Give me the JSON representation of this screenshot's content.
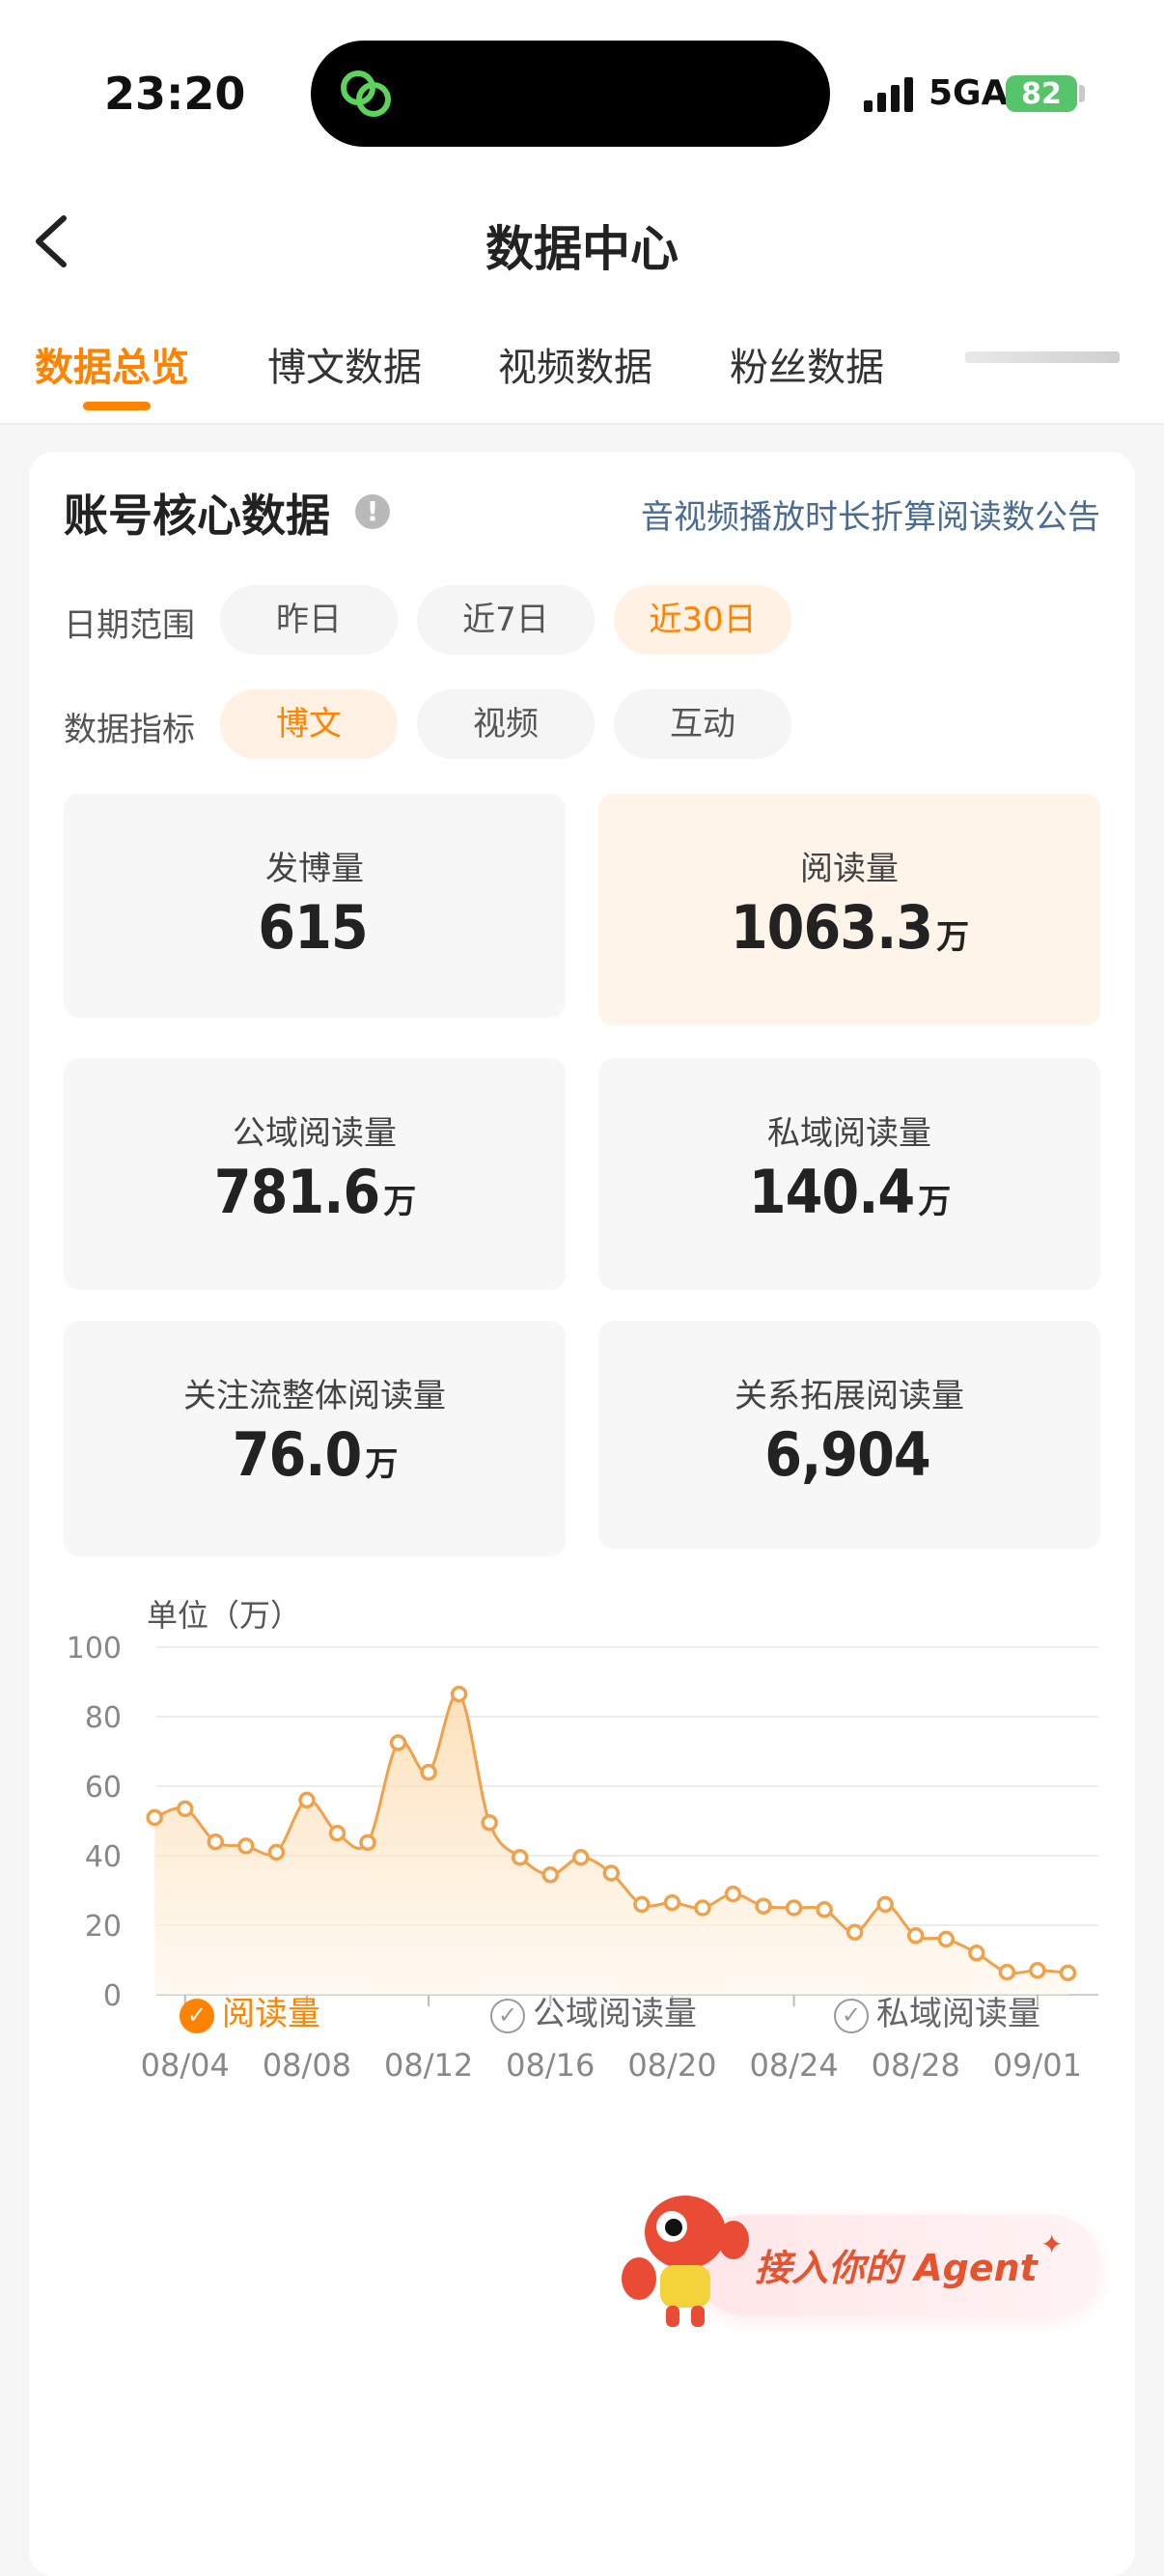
{
  "status": {
    "time": "23:20",
    "network": "5GA",
    "battery": "82"
  },
  "header": {
    "title": "数据中心"
  },
  "tabs": [
    {
      "label": "数据总览",
      "active": true
    },
    {
      "label": "博文数据"
    },
    {
      "label": "视频数据"
    },
    {
      "label": "粉丝数据"
    }
  ],
  "card": {
    "title": "账号核心数据",
    "notice": "音视频播放时长折算阅读数公告",
    "date_label": "日期范围",
    "date_options": [
      "昨日",
      "近7日",
      "近30日"
    ],
    "date_selected": "近30日",
    "metric_label": "数据指标",
    "metric_options": [
      "博文",
      "视频",
      "互动"
    ],
    "metric_selected": "博文"
  },
  "metrics": [
    {
      "label": "发博量",
      "value": "615",
      "unit": ""
    },
    {
      "label": "阅读量",
      "value": "1063.3",
      "unit": "万"
    },
    {
      "label": "公域阅读量",
      "value": "781.6",
      "unit": "万"
    },
    {
      "label": "私域阅读量",
      "value": "140.4",
      "unit": "万"
    },
    {
      "label": "关注流整体阅读量",
      "value": "76.0",
      "unit": "万"
    },
    {
      "label": "关系拓展阅读量",
      "value": "6,904",
      "unit": ""
    }
  ],
  "chart_unit": "单位（万）",
  "chart_data": {
    "type": "area",
    "x": [
      "08/03",
      "08/04",
      "08/05",
      "08/06",
      "08/07",
      "08/08",
      "08/09",
      "08/10",
      "08/11",
      "08/12",
      "08/13",
      "08/14",
      "08/15",
      "08/16",
      "08/17",
      "08/18",
      "08/19",
      "08/20",
      "08/21",
      "08/22",
      "08/23",
      "08/24",
      "08/25",
      "08/26",
      "08/27",
      "08/28",
      "08/29",
      "08/30",
      "08/31",
      "09/01",
      "09/02"
    ],
    "x_ticks": [
      "08/04",
      "08/08",
      "08/12",
      "08/16",
      "08/20",
      "08/24",
      "08/28",
      "09/01"
    ],
    "series": [
      {
        "name": "阅读量",
        "values": [
          51,
          53.5,
          44,
          42.8,
          41,
          56,
          46.5,
          43.8,
          72.5,
          64,
          86.5,
          49.5,
          39.5,
          34.5,
          39.5,
          35,
          26,
          26.5,
          25,
          29,
          25.5,
          25,
          24.5,
          18,
          26,
          17,
          16,
          12,
          6.5,
          7,
          6.3
        ]
      }
    ],
    "ylim": [
      0,
      100
    ],
    "y_ticks": [
      0,
      20,
      40,
      60,
      80,
      100
    ],
    "grid": true,
    "legend": [
      {
        "name": "阅读量",
        "checked": true
      },
      {
        "name": "公域阅读量",
        "checked": false
      },
      {
        "name": "私域阅读量",
        "checked": false
      }
    ],
    "color": "#f0a14a"
  },
  "agent_banner": {
    "text": "接入你的 Agent"
  }
}
